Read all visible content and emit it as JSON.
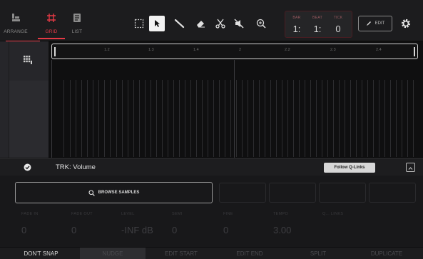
{
  "colors": {
    "accent": "#e53945",
    "background": "#141414",
    "topbar": "#1c1c1e"
  },
  "modes": [
    {
      "label": "ARRANGE",
      "icon": "arrange-icon",
      "active": false
    },
    {
      "label": "GRID",
      "icon": "grid-hash-icon",
      "active": true
    },
    {
      "label": "LIST",
      "icon": "list-document-icon",
      "active": false
    }
  ],
  "tools": [
    {
      "name": "select-rectangle-icon",
      "active": false
    },
    {
      "name": "pointer-arrow-icon",
      "active": true
    },
    {
      "name": "pencil-icon",
      "active": false
    },
    {
      "name": "eraser-icon",
      "active": false
    },
    {
      "name": "scissors-icon",
      "active": false
    },
    {
      "name": "mute-icon",
      "active": false
    },
    {
      "name": "zoom-icon",
      "active": false
    }
  ],
  "counter": {
    "bar_label": "BAR",
    "beat_label": "BEAT",
    "tick_label": "TICK",
    "bar": "1:",
    "beat": "1:",
    "tick": "0"
  },
  "edit_button": "EDIT",
  "ruler_ticks": [
    "1.2",
    "1.3",
    "1.4",
    "2",
    "2.2",
    "2.3",
    "2.4"
  ],
  "track": {
    "label": "TRK: Volume",
    "follow_qlinks": "Follow Q-Links"
  },
  "browse_samples": "BROWSE SAMPLES",
  "disabled_buttons": [
    "",
    "",
    "",
    ""
  ],
  "params": [
    {
      "label": "FADE IN",
      "value": "0"
    },
    {
      "label": "FADE OUT",
      "value": "0"
    },
    {
      "label": "LEVEL",
      "value": "-INF dB"
    },
    {
      "label": "SEMI",
      "value": "0"
    },
    {
      "label": "FINE",
      "value": "0"
    },
    {
      "label": "TEMPO",
      "value": "3.00"
    },
    {
      "label": "Q... LINKS",
      "value": ""
    }
  ],
  "bottom": {
    "dont_snap": "DON'T SNAP",
    "nudge": "NUDGE",
    "edit_start": "EDIT START",
    "edit_end": "EDIT END",
    "split": "SPLIT",
    "duplicate": "DUPLICATE"
  }
}
